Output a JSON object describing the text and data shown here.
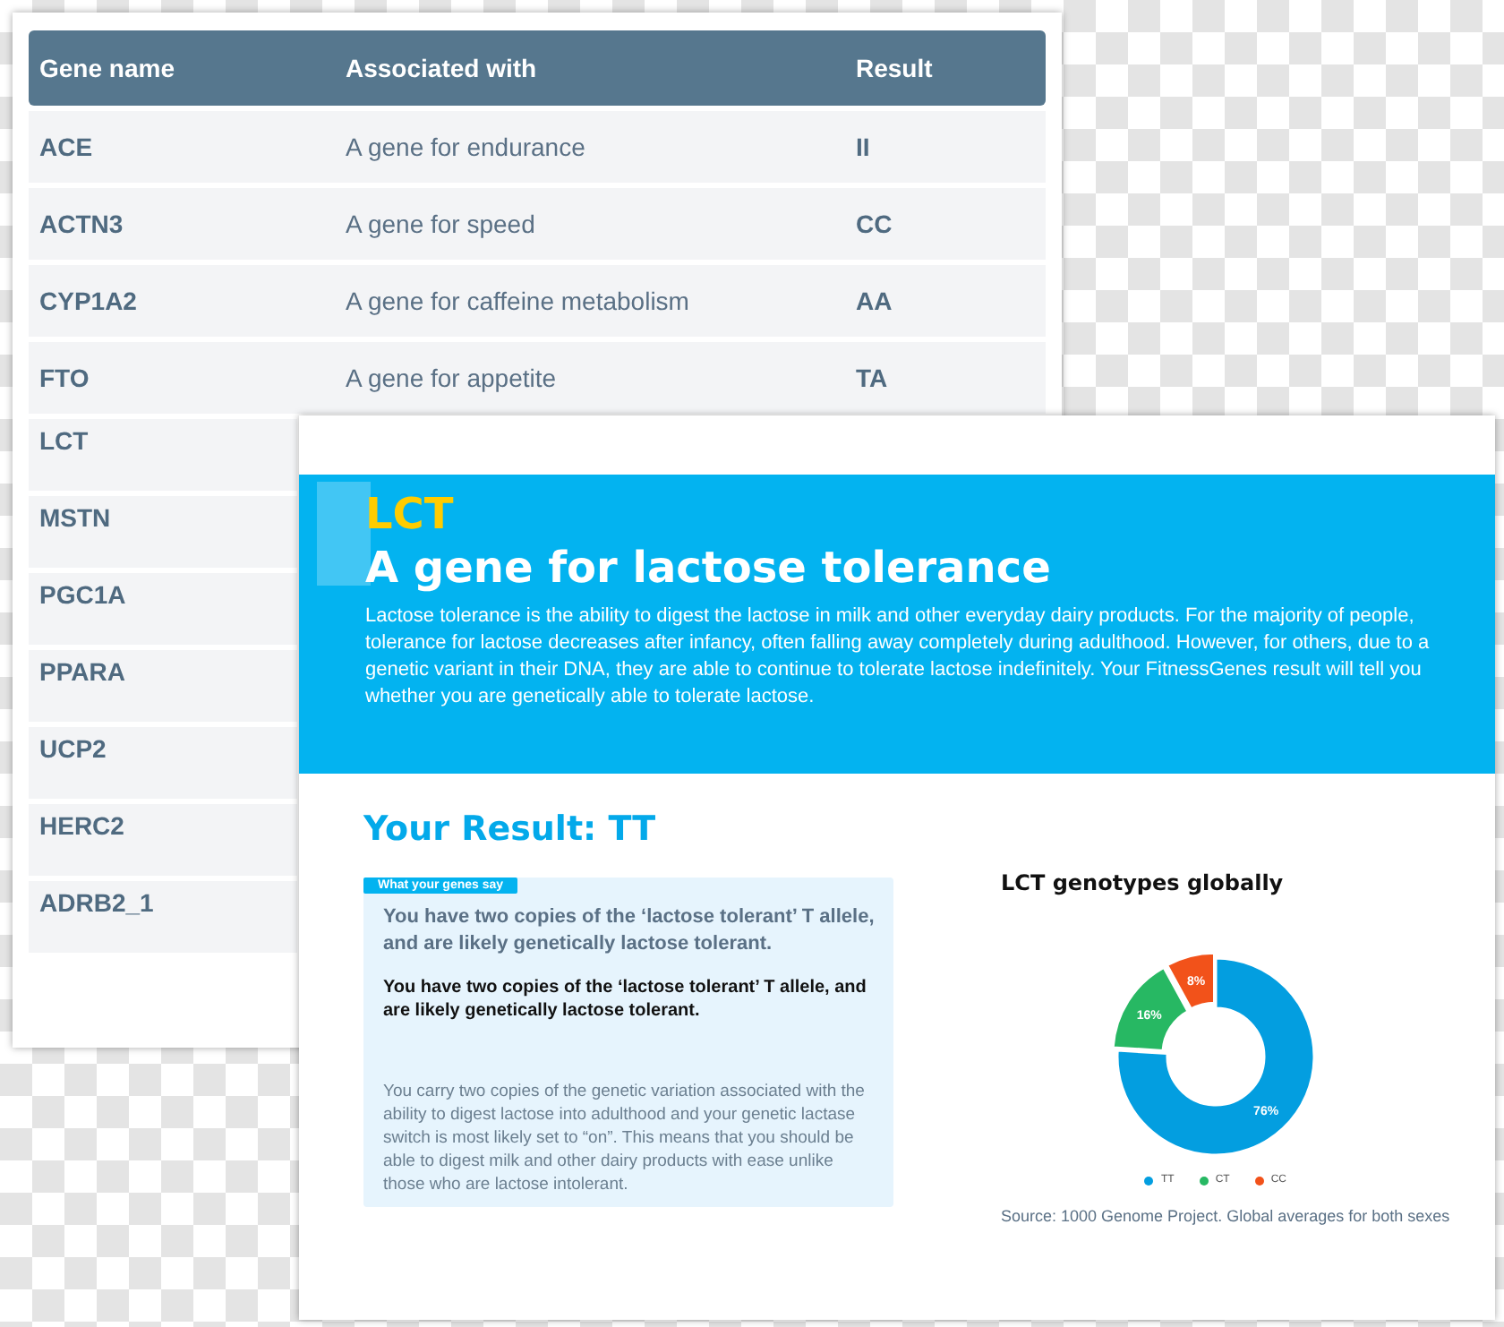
{
  "gene_table": {
    "columns": [
      "Gene name",
      "Associated with",
      "Result"
    ],
    "rows": [
      {
        "gene": "ACE",
        "associated": "A gene for endurance",
        "result": "II"
      },
      {
        "gene": "ACTN3",
        "associated": "A gene for speed",
        "result": "CC"
      },
      {
        "gene": "CYP1A2",
        "associated": "A gene for caffeine metabolism",
        "result": "AA"
      },
      {
        "gene": "FTO",
        "associated": "A gene for appetite",
        "result": "TA"
      },
      {
        "gene": "LCT"
      },
      {
        "gene": "MSTN"
      },
      {
        "gene": "PGC1A"
      },
      {
        "gene": "PPARA"
      },
      {
        "gene": "UCP2"
      },
      {
        "gene": "HERC2"
      },
      {
        "gene": "ADRB2_1"
      }
    ]
  },
  "report": {
    "gene": "LCT",
    "title": "A gene for lactose tolerance",
    "intro": "Lactose tolerance is the ability to digest the lactose in milk and other everyday dairy products. For the majority of people, tolerance for lactose decreases after infancy, often falling away completely during adulthood. However, for others, due to a genetic variant in their DNA, they are able to continue to tolerate lactose indefinitely. Your FitnessGenes result will tell you whether you are genetically able to tolerate lactose.",
    "result_heading": "Your Result: TT",
    "genes_say": {
      "tag": "What your genes say",
      "summary": "You have two copies of the ‘lactose tolerant’ T allele, and are likely genetically lactose tolerant.",
      "summary_bold": "You have two copies of the ‘lactose tolerant’ T allele, and are likely genetically lactose tolerant.",
      "detail": "You carry two copies of the genetic variation associated with the ability to digest lactose into adulthood and your genetic lactase switch is most likely set to “on”. This means that you should be able to digest milk and other dairy products with ease unlike those who are lactose intolerant."
    },
    "chart_data": {
      "type": "donut",
      "title": "LCT genotypes globally",
      "categories": [
        "TT",
        "CT",
        "CC"
      ],
      "series": [
        {
          "colors": [
            "#039ee0",
            "#27b863",
            "#f2521a"
          ],
          "values": [
            76,
            16,
            8
          ]
        }
      ],
      "value_labels": [
        "76%",
        "16%",
        "8%"
      ]
    },
    "source": "Source: 1000 Genome Project. Global averages for both sexes"
  }
}
